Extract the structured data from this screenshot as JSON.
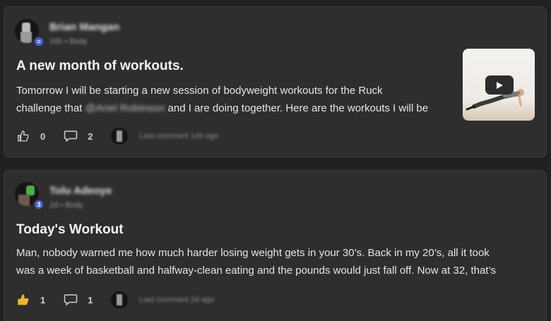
{
  "posts": [
    {
      "author": "Brian Mangan",
      "meta": "16h • Body",
      "title": "A new month of workouts.",
      "body_before": "Tomorrow I will be starting a new session of bodyweight workouts for the Ruck",
      "body_line2_start": "challenge that ",
      "body_tagged": "@Ariel Robinson",
      "body_line2_end": " and I are doing together. Here are the workouts I will be",
      "likes": "0",
      "comments": "2",
      "last_comment": "Last comment 14h ago",
      "has_video": true,
      "liked": false
    },
    {
      "author": "Tolu Adeoye",
      "meta": "2d • Body",
      "title": "Today's Workout",
      "body_line1": "Man, nobody warned me how much harder losing weight gets in your 30’s. Back in my 20’s, all it took",
      "body_line2": "was a week of basketball and halfway-clean eating and the pounds would just fall off. Now at 32, that’s",
      "likes": "1",
      "comments": "1",
      "last_comment": "Last comment 2d ago",
      "liked": true
    }
  ],
  "colors": {
    "accent_badge": "#4a5fd4",
    "like_active": "#f2b431"
  },
  "icons": {
    "like": "thumbs-up-icon",
    "comment": "comment-bubble-icon",
    "play": "play-icon"
  }
}
